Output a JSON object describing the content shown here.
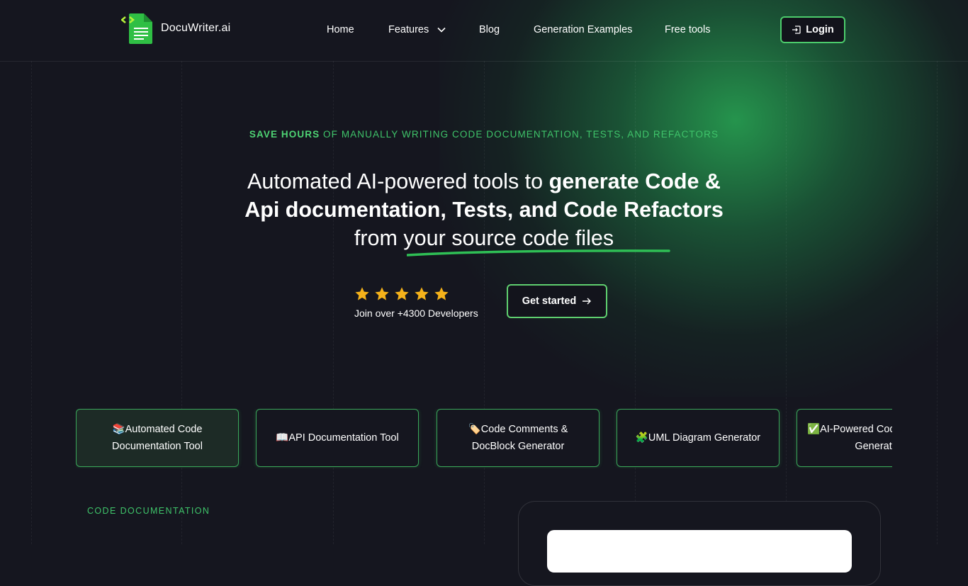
{
  "brand": {
    "name": "DocuWriter.ai",
    "accent": "#4ccc6c"
  },
  "nav": {
    "items": [
      "Home",
      "Features",
      "Blog",
      "Generation Examples",
      "Free tools"
    ],
    "login_label": "Login"
  },
  "hero": {
    "eyebrow_bold": "SAVE HOURS",
    "eyebrow_rest": " OF MANUALLY WRITING CODE DOCUMENTATION, TESTS, AND REFACTORS",
    "headline_part1": "Automated AI-powered tools to ",
    "headline_bold": "generate Code & Api documentation, Tests, and Code Refactors",
    "headline_part2": " from your source code files",
    "rating_stars": 5,
    "join_text": "Join over +4300 Developers",
    "cta_label": "Get started"
  },
  "cards": [
    {
      "emoji": "📚",
      "label": "Automated Code Documentation Tool"
    },
    {
      "emoji": "📖",
      "label": "API Documentation Tool"
    },
    {
      "emoji": "🏷️",
      "label": "Code Comments & DocBlock Generator"
    },
    {
      "emoji": "🧩",
      "label": "UML Diagram Generator"
    },
    {
      "emoji": "✅",
      "label": "AI-Powered Code Test Suite Generator"
    }
  ],
  "section": {
    "label": "CODE DOCUMENTATION"
  }
}
